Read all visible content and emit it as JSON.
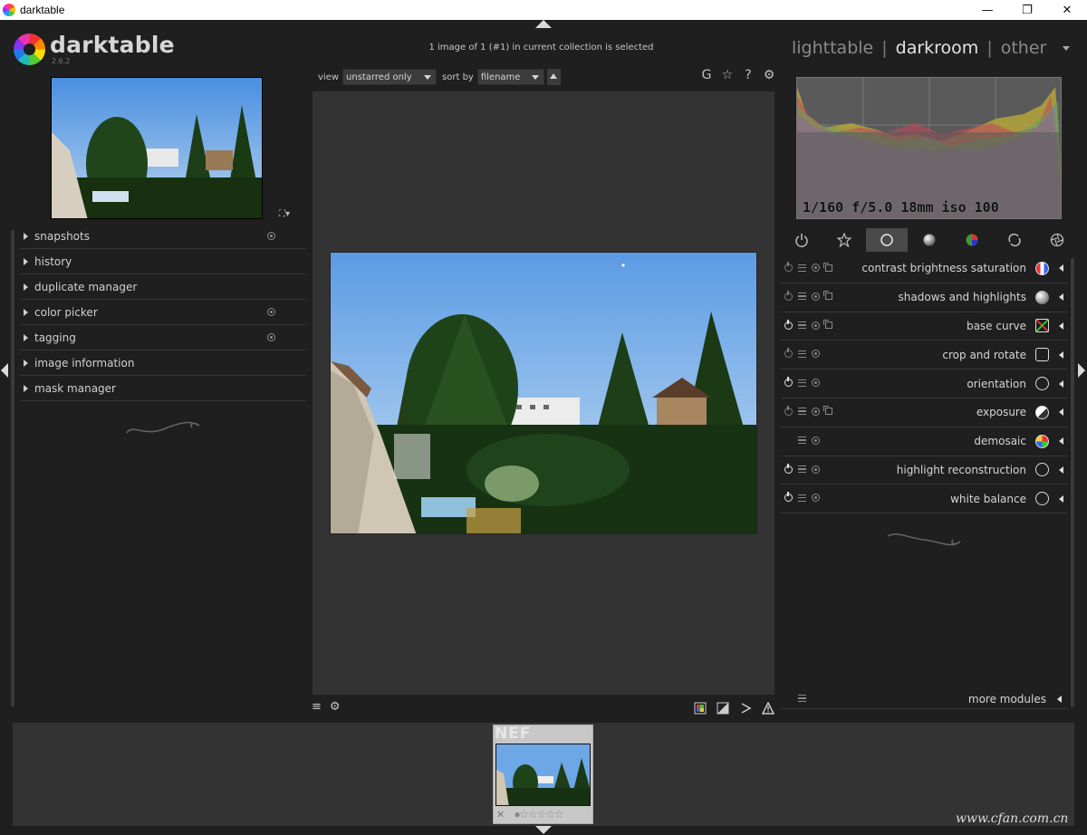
{
  "window": {
    "title": "darktable",
    "minimize_glyph": "—",
    "maximize_glyph": "❐",
    "close_glyph": "✕"
  },
  "logo": {
    "name": "darktable",
    "version": "2.6.2"
  },
  "header": {
    "collection_info": "1 image of 1 (#1) in current collection is selected",
    "views": [
      "lighttable",
      "darkroom",
      "other"
    ],
    "active_view": "darkroom",
    "separator": "|"
  },
  "filter_bar": {
    "view_label": "view",
    "view_value": "unstarred only",
    "sort_label": "sort by",
    "sort_value": "filename",
    "icons": [
      "G",
      "☆",
      "?",
      "⚙"
    ]
  },
  "left_panel": {
    "expand_glyph": "⛶▾",
    "modules": [
      {
        "label": "snapshots",
        "has_reset": true
      },
      {
        "label": "history",
        "has_reset": false
      },
      {
        "label": "duplicate manager",
        "has_reset": false
      },
      {
        "label": "color picker",
        "has_reset": true
      },
      {
        "label": "tagging",
        "has_reset": true
      },
      {
        "label": "image information",
        "has_reset": false
      },
      {
        "label": "mask manager",
        "has_reset": false
      }
    ]
  },
  "histogram": {
    "exif": "1/160 f/5.0 18mm iso 100"
  },
  "module_groups": [
    "active-modules-icon",
    "favorites-icon",
    "basic-group-icon",
    "tone-group-icon",
    "color-group-icon",
    "correct-group-icon",
    "effect-group-icon"
  ],
  "active_group_index": 2,
  "right_modules": [
    {
      "label": "contrast brightness saturation",
      "power": false,
      "presets": true,
      "icon": "contrast-icon"
    },
    {
      "label": "shadows and highlights",
      "power": false,
      "presets": true,
      "icon": "shadows-icon"
    },
    {
      "label": "base curve",
      "power": true,
      "presets": true,
      "icon": "curve-icon"
    },
    {
      "label": "crop and rotate",
      "power": false,
      "presets": false,
      "icon": "crop-icon"
    },
    {
      "label": "orientation",
      "power": true,
      "presets": false,
      "icon": "orientation-icon"
    },
    {
      "label": "exposure",
      "power": false,
      "presets": true,
      "icon": "exposure-icon"
    },
    {
      "label": "demosaic",
      "power": null,
      "presets": false,
      "icon": "demosaic-icon"
    },
    {
      "label": "highlight reconstruction",
      "power": true,
      "presets": false,
      "icon": "highlight-icon"
    },
    {
      "label": "white balance",
      "power": true,
      "presets": false,
      "icon": "white-balance-icon"
    }
  ],
  "more_modules": {
    "label": "more modules"
  },
  "center_bottom": {
    "left_icons": [
      "≡",
      "⚙"
    ]
  },
  "filmstrip": {
    "ext_label": "NEF",
    "reject_glyph": "✕",
    "stars": "☆☆☆☆☆",
    "dot": "●"
  },
  "watermark": "www.cfan.com.cn"
}
